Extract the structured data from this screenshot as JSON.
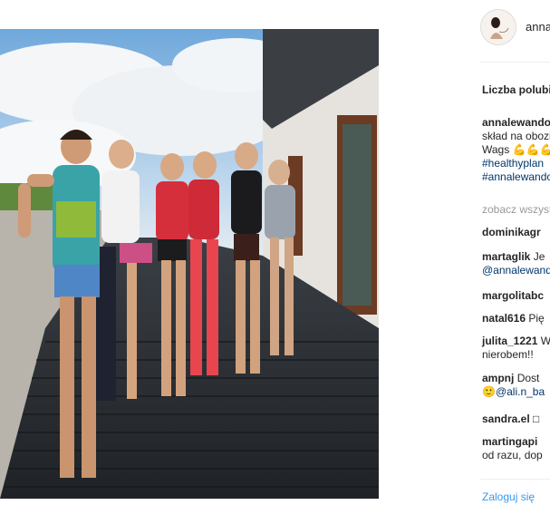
{
  "post": {
    "username": "annalewandowska",
    "likes_label": "Liczba polubień",
    "caption": {
      "username": "annalewandowska",
      "line1": "skład na obozie",
      "line2": "Wags 💪💪💪",
      "tag1": "#healthyplan",
      "tag2": "#annalewandowska"
    },
    "view_all": "zobacz wszystkie komentarze",
    "comments": [
      {
        "user": "dominikagr",
        "text": ""
      },
      {
        "user": "martaglik",
        "text": "Je",
        "line2": "@annalewandowska",
        "line2_is_mention": true
      },
      {
        "user": "margolitabc",
        "text": ""
      },
      {
        "user": "natal616",
        "text": "Pię"
      },
      {
        "user": "julita_1221",
        "text": "Wow",
        "line2": "nierobem!!",
        "line2_is_mention": false
      },
      {
        "user": "ampnj",
        "text": "Dost",
        "line2": "🙂@ali.n_ba",
        "line2_is_mention": true
      },
      {
        "user": "sandra.el",
        "text": "□"
      },
      {
        "user": "martingapi",
        "text": "",
        "line2": "od razu, dop",
        "line2_is_mention": false
      }
    ],
    "login_link": "Zaloguj się"
  },
  "colors": {
    "link": "#3897f0",
    "hashtag": "#003569",
    "muted": "#999999",
    "text": "#262626"
  }
}
